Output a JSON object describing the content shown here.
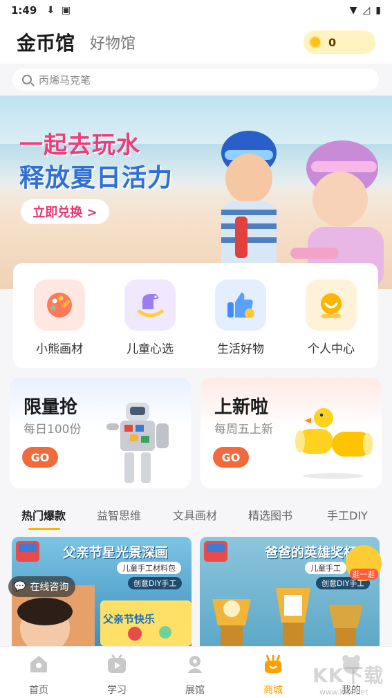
{
  "status_bar": {
    "time": "1:49"
  },
  "header": {
    "tab_active": "金币馆",
    "tab_inactive": "好物馆",
    "coins": "0"
  },
  "search": {
    "placeholder": "丙烯马克笔"
  },
  "banner": {
    "line1": "一起去玩水",
    "line2": "释放夏日活力",
    "cta": "立即兑换 >"
  },
  "categories": [
    {
      "label": "小熊画材",
      "icon": "palette-icon",
      "bg": "#ffe8e2"
    },
    {
      "label": "儿童心选",
      "icon": "rocking-horse-icon",
      "bg": "#efe8ff"
    },
    {
      "label": "生活好物",
      "icon": "thumbs-up-icon",
      "bg": "#e3efff"
    },
    {
      "label": "个人中心",
      "icon": "smile-face-icon",
      "bg": "#fff2d9"
    }
  ],
  "promos": [
    {
      "title": "限量抢",
      "subtitle": "每日100份",
      "button": "GO"
    },
    {
      "title": "上新啦",
      "subtitle": "每周五上新",
      "button": "GO"
    }
  ],
  "product_tabs": [
    "热门爆款",
    "益智思维",
    "文具画材",
    "精选图书",
    "手工DIY"
  ],
  "products": [
    {
      "title": "父亲节星光景深画",
      "tag1": "儿童手工材料包",
      "tag2": "创意DIY手工",
      "inner": "父亲节快乐"
    },
    {
      "title": "爸爸的英雄奖杯",
      "tag1": "儿童手工",
      "tag2": "创意DIY手工"
    }
  ],
  "chat": {
    "label": "在线咨询"
  },
  "float_badge": {
    "label": "逛一逛"
  },
  "nav": [
    {
      "label": "首页",
      "icon": "home-icon"
    },
    {
      "label": "学习",
      "icon": "play-icon"
    },
    {
      "label": "展馆",
      "icon": "gallery-icon"
    },
    {
      "label": "商城",
      "icon": "shop-icon"
    },
    {
      "label": "我的",
      "icon": "profile-icon"
    }
  ],
  "watermark": {
    "text": "KK下载",
    "url": "www.kkx.net"
  },
  "colors": {
    "accent": "#ff9d00",
    "go": "#f26a3b",
    "coin_bg": "#fff3c2"
  }
}
